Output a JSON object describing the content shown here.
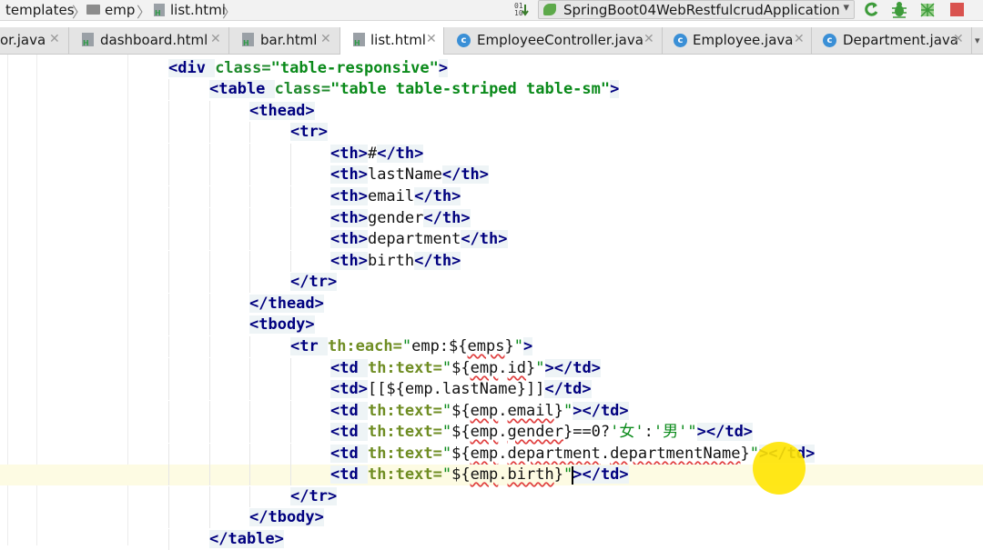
{
  "breadcrumb": [
    "templates",
    "emp",
    "list.html"
  ],
  "run_config": {
    "label": "SpringBoot04WebRestfulcrudApplication"
  },
  "tabs": [
    {
      "label": "or.java",
      "icon": "java-class-icon",
      "active": false
    },
    {
      "label": "dashboard.html",
      "icon": "html-file-icon",
      "active": false
    },
    {
      "label": "bar.html",
      "icon": "html-file-icon",
      "active": false
    },
    {
      "label": "list.html",
      "icon": "html-file-icon",
      "active": true
    },
    {
      "label": "EmployeeController.java",
      "icon": "java-class-icon",
      "active": false
    },
    {
      "label": "Employee.java",
      "icon": "java-class-icon",
      "active": false
    },
    {
      "label": "Department.java",
      "icon": "java-class-icon",
      "active": false
    }
  ],
  "code": {
    "l1": {
      "open": "<div ",
      "attr": "class=",
      "val": "\"table-responsive\"",
      "close": ">"
    },
    "l2": {
      "open": "<table ",
      "attr": "class=",
      "val": "\"table table-striped table-sm\"",
      "close": ">"
    },
    "l3": "<thead>",
    "l4": "<tr>",
    "th1": {
      "open": "<th>",
      "text": "#",
      "close": "</th>"
    },
    "th2": {
      "open": "<th>",
      "text": "lastName",
      "close": "</th>"
    },
    "th3": {
      "open": "<th>",
      "text": "email",
      "close": "</th>"
    },
    "th4": {
      "open": "<th>",
      "text": "gender",
      "close": "</th>"
    },
    "th5": {
      "open": "<th>",
      "text": "department",
      "close": "</th>"
    },
    "th6": {
      "open": "<th>",
      "text": "birth",
      "close": "</th>"
    },
    "l11": "</tr>",
    "l12": "</thead>",
    "l13": "<tbody>",
    "l14": {
      "open": "<tr ",
      "attr": "th:each=",
      "q1": "\"",
      "a": "emp:${",
      "b": "emps",
      "c": "}",
      "q2": "\"",
      "close": ">"
    },
    "td1": {
      "open": "<td ",
      "attr": "th:text=",
      "q1": "\"",
      "a": "${",
      "b": "emp",
      "c": ".",
      "d": "id",
      "e": "}",
      "q2": "\"",
      "close": "></td>"
    },
    "td2": {
      "open": "<td>",
      "text": "[[${emp.lastName}]]",
      "close": "</td>"
    },
    "td3": {
      "open": "<td ",
      "attr": "th:text=",
      "q1": "\"",
      "a": "${",
      "b": "emp",
      "c": ".",
      "d": "email",
      "e": "}",
      "q2": "\"",
      "close": "></td>"
    },
    "td4": {
      "open": "<td ",
      "attr": "th:text=",
      "q1": "\"",
      "a": "${",
      "b": "emp",
      "c": ".",
      "d": "gender",
      "e": "}==0?",
      "f": "'女'",
      "g": ":",
      "h": "'男'",
      "q2": "\"",
      "close": "></td>"
    },
    "td5": {
      "open": "<td ",
      "attr": "th:text=",
      "q1": "\"",
      "a": "${",
      "b": "emp",
      "c": ".",
      "d": "department",
      "e": ".",
      "f": "departmentName",
      "g": "}",
      "q2": "\"",
      "close": "></td>"
    },
    "td6": {
      "open": "<td ",
      "attr": "th:text=",
      "q1": "\"",
      "a": "${",
      "b": "emp",
      "c": ".",
      "d": "birth",
      "e": "}",
      "q2": "\"",
      "close": "></td>"
    },
    "l21": "</tr>",
    "l22": "</tbody>",
    "l23": "</table>"
  }
}
